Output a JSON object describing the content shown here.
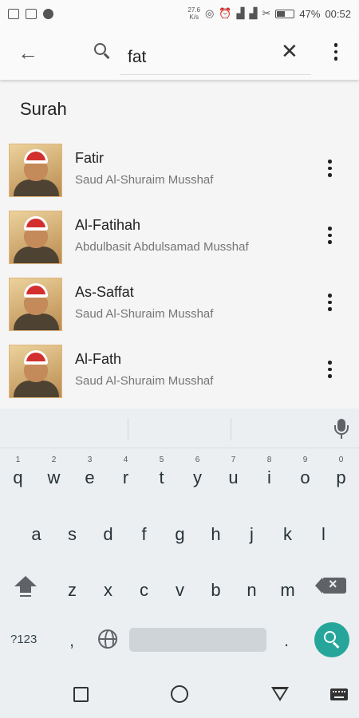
{
  "status_bar": {
    "net_speed": "27.6",
    "net_unit": "K/s",
    "battery": "47%",
    "time": "00:52"
  },
  "search": {
    "query": "fat"
  },
  "section_title": "Surah",
  "results": [
    {
      "title": "Fatir",
      "subtitle": "Saud Al-Shuraim Musshaf"
    },
    {
      "title": "Al-Fatihah",
      "subtitle": "Abdulbasit Abdulsamad Musshaf"
    },
    {
      "title": "As-Saffat",
      "subtitle": "Saud Al-Shuraim Musshaf"
    },
    {
      "title": "Al-Fath",
      "subtitle": "Saud Al-Shuraim Musshaf"
    }
  ],
  "keyboard": {
    "row1": [
      {
        "k": "q",
        "h": "1"
      },
      {
        "k": "w",
        "h": "2"
      },
      {
        "k": "e",
        "h": "3"
      },
      {
        "k": "r",
        "h": "4"
      },
      {
        "k": "t",
        "h": "5"
      },
      {
        "k": "y",
        "h": "6"
      },
      {
        "k": "u",
        "h": "7"
      },
      {
        "k": "i",
        "h": "8"
      },
      {
        "k": "o",
        "h": "9"
      },
      {
        "k": "p",
        "h": "0"
      }
    ],
    "row2": [
      "a",
      "s",
      "d",
      "f",
      "g",
      "h",
      "j",
      "k",
      "l"
    ],
    "row3": [
      "z",
      "x",
      "c",
      "v",
      "b",
      "n",
      "m"
    ],
    "symbols_label": "?123",
    "comma": ",",
    "period": "."
  },
  "colors": {
    "accent": "#26a69a",
    "thumb_cap": "#d32f2f"
  },
  "icons": [
    "back-arrow-icon",
    "search-icon",
    "close-icon",
    "more-vert-icon",
    "mic-icon",
    "shift-icon",
    "backspace-icon",
    "globe-icon",
    "recent-apps-icon",
    "home-icon",
    "nav-back-icon",
    "keyboard-icon"
  ]
}
